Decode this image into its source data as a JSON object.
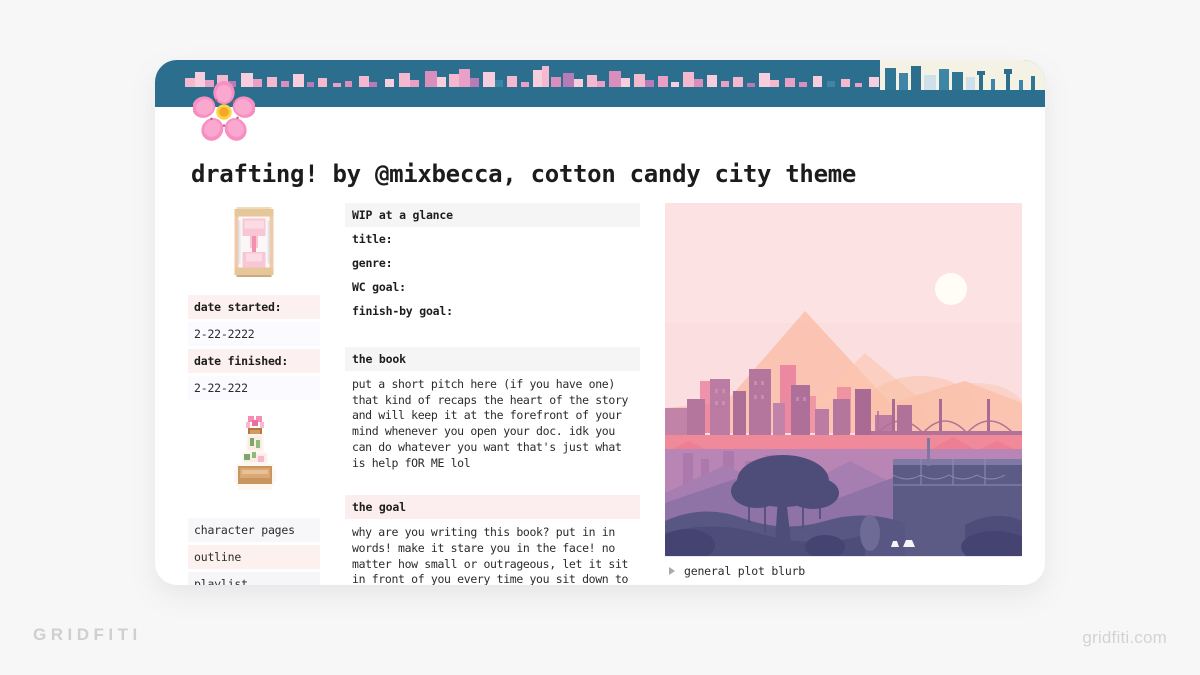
{
  "watermark": {
    "left": "GRIDFITI",
    "right": "gridfiti.com"
  },
  "page": {
    "title": "drafting! by @mixbecca, cotton candy city theme"
  },
  "banner": {
    "sky_color": "#2b6e8e",
    "right_block_color": "#f4f2e4",
    "pixel_colors": [
      "#f4b8cf",
      "#e8a0c6",
      "#b57cb8",
      "#d98fbe",
      "#3f86a6",
      "#f7cede"
    ],
    "decor_icon": "cherry-blossom-emoji"
  },
  "sidebar": {
    "hourglass_icon": "pixel-hourglass",
    "potion_icon": "pixel-flower-potion",
    "fields": [
      {
        "label": "date started:",
        "value": "2-22-2222"
      },
      {
        "label": "date finished:",
        "value": "2-22-222"
      }
    ],
    "nav": [
      "character pages",
      "outline",
      "playlist"
    ]
  },
  "main": {
    "glance": {
      "heading": "WIP at a glance",
      "fields": [
        "title:",
        "genre:",
        "WC goal:",
        "finish-by goal:"
      ]
    },
    "book": {
      "heading": "the book",
      "body": "put a short pitch here (if you have one)\nthat kind of recaps the heart of the story\nand will keep it at the forefront of your\nmind whenever you open your doc. idk you\ncan do whatever you want that's just what\nis help fOR ME lol"
    },
    "goal": {
      "heading": "the goal",
      "body": "why are you writing this book? put in in\nwords! make it stare you in the face! no\nmatter how small or outrageous, let it sit\nin front of you every time you sit down to\nwork."
    }
  },
  "illustration": {
    "alt": "pastel cotton candy city sunset with bridge and tree",
    "sky_color": "#fbdfe0",
    "sun_color": "#fffdf6",
    "blurb_label": "general plot blurb",
    "toggle_icon": "triangle-right-icon"
  }
}
